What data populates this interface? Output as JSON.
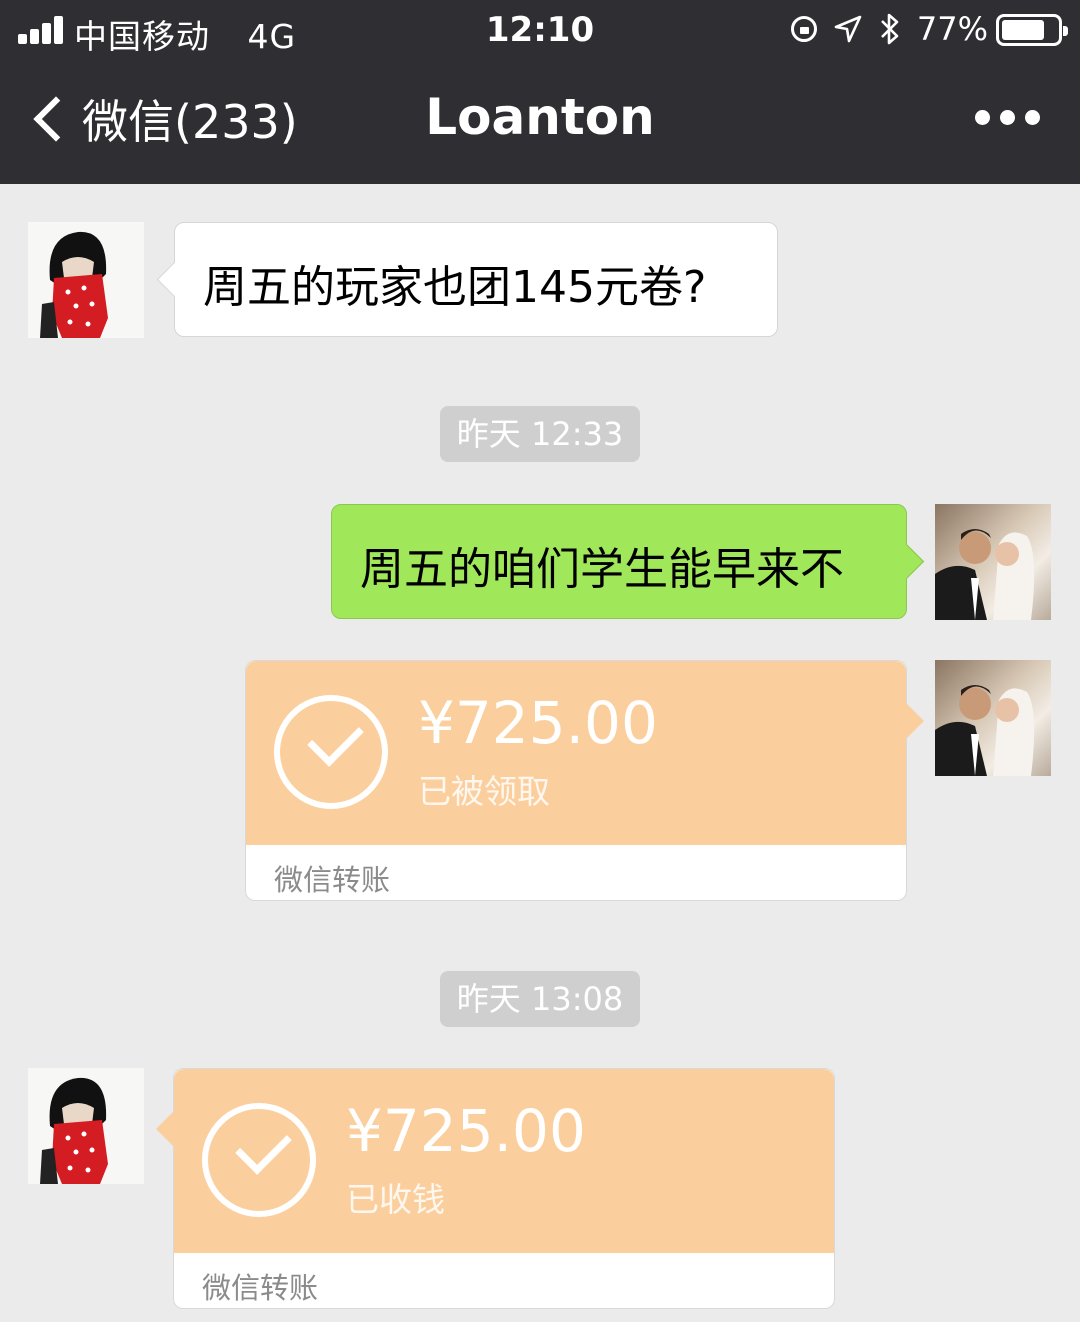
{
  "status_bar": {
    "carrier": "中国移动",
    "network": "4G",
    "time": "12:10",
    "battery_percent": "77%",
    "battery_level": 0.77
  },
  "nav": {
    "back_label": "微信(233)",
    "title": "Loanton"
  },
  "messages": [
    {
      "side": "left",
      "type": "text",
      "text": "周五的玩家也团145元卷?"
    },
    {
      "type": "timestamp",
      "text": "昨天 12:33"
    },
    {
      "side": "right",
      "type": "text",
      "text": "周五的咱们学生能早来不"
    },
    {
      "side": "right",
      "type": "transfer",
      "amount": "¥725.00",
      "status": "已被领取",
      "footer": "微信转账"
    },
    {
      "type": "timestamp",
      "text": "昨天 13:08"
    },
    {
      "side": "left",
      "type": "transfer",
      "amount": "¥725.00",
      "status": "已收钱",
      "footer": "微信转账"
    }
  ],
  "colors": {
    "nav_bg": "#2f2e33",
    "chat_bg": "#ebebeb",
    "sent_bubble": "#a0e75a",
    "transfer_card": "#fbcf9d"
  },
  "icons": {
    "back": "chevron-left-icon",
    "more": "more-dots-icon",
    "signal": "signal-bars-icon",
    "rotation_lock": "rotation-lock-icon",
    "location": "location-arrow-icon",
    "bluetooth": "bluetooth-icon",
    "battery": "battery-icon",
    "check": "check-circle-icon"
  }
}
